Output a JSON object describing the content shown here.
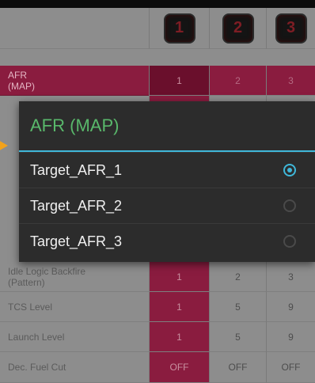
{
  "table": {
    "headers": [
      "1",
      "2",
      "3"
    ],
    "rows": [
      {
        "label": "AFR\n(MAP)",
        "values": [
          "1",
          "2",
          "3"
        ]
      },
      {
        "label": "",
        "values": [
          "",
          "",
          ""
        ]
      },
      {
        "label": "",
        "values": [
          "",
          "",
          ""
        ]
      },
      {
        "label": "",
        "values": [
          "",
          "",
          ""
        ]
      },
      {
        "label": "",
        "values": [
          "",
          "",
          ""
        ]
      },
      {
        "label": "Idle Logic Backfire\n(Pattern)",
        "values": [
          "1",
          "2",
          "3"
        ]
      },
      {
        "label": "TCS Level",
        "values": [
          "1",
          "5",
          "9"
        ]
      },
      {
        "label": "Launch Level",
        "values": [
          "1",
          "5",
          "9"
        ]
      },
      {
        "label": "Dec. Fuel Cut",
        "values": [
          "OFF",
          "OFF",
          "OFF"
        ]
      }
    ]
  },
  "dialog": {
    "title": "AFR (MAP)",
    "options": [
      {
        "label": "Target_AFR_1",
        "selected": true
      },
      {
        "label": "Target_AFR_2",
        "selected": false
      },
      {
        "label": "Target_AFR_3",
        "selected": false
      }
    ]
  },
  "colors": {
    "accent": "#3fb7d9",
    "title_green": "#59b86b",
    "highlight": "#8a1c3f",
    "arrow": "#f2a21b"
  }
}
